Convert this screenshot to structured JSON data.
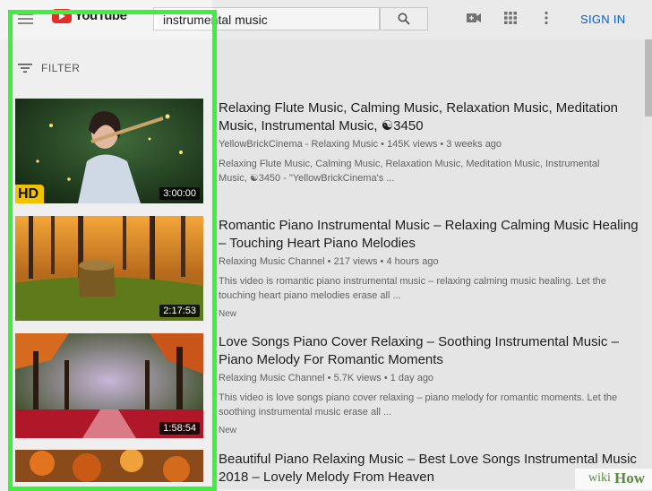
{
  "app": {
    "logo_text": "YouTube"
  },
  "search": {
    "query": "instrumental music"
  },
  "header": {
    "sign_in": "SIGN IN"
  },
  "filter": {
    "label": "FILTER"
  },
  "results": [
    {
      "title": "Relaxing Flute Music, Calming Music, Relaxation Music, Meditation Music, Instrumental Music, ☯3450",
      "meta": "YellowBrickCinema - Relaxing Music • 145K views • 3 weeks ago",
      "description": "Relaxing Flute Music, Calming Music, Relaxation Music, Meditation Music, Instrumental Music, ☯3450 - \"YellowBrickCinema's ...",
      "duration": "3:00:00",
      "badge": "HD"
    },
    {
      "title": "Romantic Piano Instrumental Music – Relaxing Calming Music Healing – Touching Heart Piano Melodies",
      "meta": "Relaxing Music Channel • 217 views • 4 hours ago",
      "description": "This video is romantic piano instrumental music – relaxing calming music healing. Let the touching heart piano melodies erase all ...",
      "duration": "2:17:53",
      "badge": "New"
    },
    {
      "title": "Love Songs Piano Cover Relaxing – Soothing Instrumental Music – Piano Melody For Romantic Moments",
      "meta": "Relaxing Music Channel • 5.7K views • 1 day ago",
      "description": "This video is love songs piano cover relaxing – piano melody for romantic moments. Let the soothing instrumental music erase all ...",
      "duration": "1:58:54",
      "badge": "New"
    },
    {
      "title": "Beautiful Piano Relaxing Music – Best Love Songs Instrumental Music 2018 – Lovely Melody From Heaven"
    }
  ],
  "watermark": {
    "wiki": "wiki",
    "how": "How"
  },
  "colors": {
    "highlight": "#3bf13b",
    "link": "#065fd4",
    "youtube_red": "#e52d27",
    "hd_badge": "#f2c200"
  }
}
